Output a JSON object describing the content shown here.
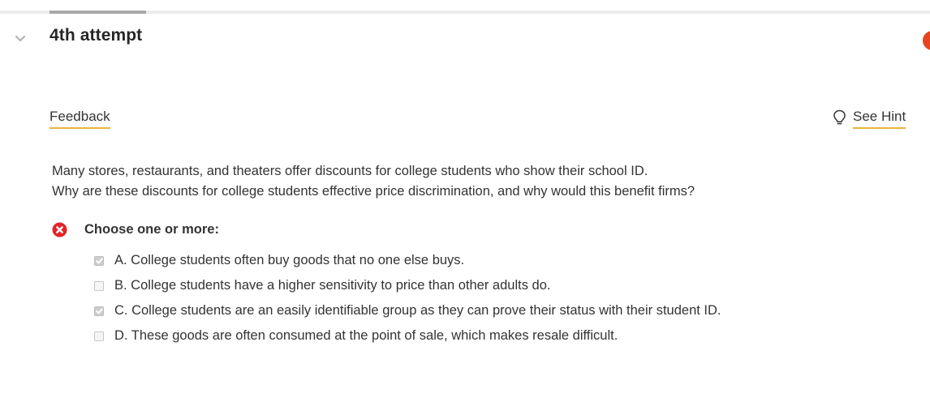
{
  "progress": {
    "fraction": 0.104
  },
  "attempt": {
    "title": "4th attempt",
    "status_color": "#e8451f"
  },
  "toolbar": {
    "feedback_label": "Feedback",
    "hint_label": "See Hint",
    "hint_icon": "lightbulb-icon",
    "accent_underline": "#e9b43c"
  },
  "question": {
    "line1": "Many stores, restaurants, and theaters offer discounts for college students who show their school ID.",
    "line2": "Why are these discounts for college students effective price discrimination, and why would this benefit firms?"
  },
  "answer": {
    "status_icon": "incorrect-icon",
    "status_color": "#e2242a",
    "prompt": "Choose one or more:",
    "options": [
      {
        "label": "A. College students often buy goods that no one else buys.",
        "checked": true
      },
      {
        "label": "B. College students have a higher sensitivity to price than other adults do.",
        "checked": false
      },
      {
        "label": "C. College students are an easily identifiable group as they can prove their status with their student ID.",
        "checked": true
      },
      {
        "label": "D. These goods are often consumed at the point of sale, which makes resale difficult.",
        "checked": false
      }
    ]
  }
}
